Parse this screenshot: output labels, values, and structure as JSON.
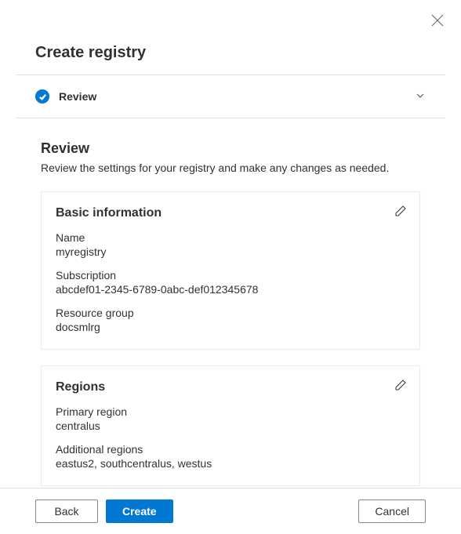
{
  "header": {
    "title": "Create registry"
  },
  "step": {
    "label": "Review"
  },
  "review": {
    "title": "Review",
    "description": "Review the settings for your registry and make any changes as needed."
  },
  "basicInfo": {
    "title": "Basic information",
    "nameLabel": "Name",
    "nameValue": "myregistry",
    "subscriptionLabel": "Subscription",
    "subscriptionValue": "abcdef01-2345-6789-0abc-def012345678",
    "resourceGroupLabel": "Resource group",
    "resourceGroupValue": "docsmlrg"
  },
  "regions": {
    "title": "Regions",
    "primaryLabel": "Primary region",
    "primaryValue": "centralus",
    "additionalLabel": "Additional regions",
    "additionalValue": "eastus2, southcentralus, westus"
  },
  "footer": {
    "back": "Back",
    "create": "Create",
    "cancel": "Cancel"
  }
}
